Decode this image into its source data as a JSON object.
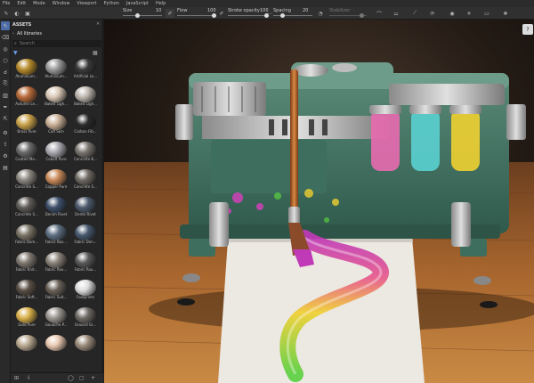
{
  "menu": [
    "File",
    "Edit",
    "Mode",
    "Window",
    "Viewport",
    "Python",
    "JavaScript",
    "Help"
  ],
  "toolbar": {
    "size_label": "Size",
    "size_value": "10",
    "flow_label": "Flow",
    "flow_value": "100",
    "stroke_opacity_label": "Stroke opacity",
    "stroke_opacity_value": "100",
    "spacing_label": "Spacing",
    "spacing_value": "20",
    "stabilizer_label": "Stabilizer"
  },
  "assets": {
    "title": "ASSETS",
    "library": "All libraries",
    "search_placeholder": "Search",
    "items": [
      "Aluminium...",
      "Aluminium...",
      "Artificial Le...",
      "Autumn Le...",
      "Baked Ligh...",
      "Baked Ligh...",
      "Brass Pure",
      "Calf Skin",
      "Carbon Fib...",
      "Coated Me...",
      "Cobalt Pure",
      "Concrete B...",
      "Concrete S...",
      "Copper Pure",
      "Concrete S...",
      "Concrete S...",
      "Denim Rivet",
      "Dente Rivet",
      "Fabric Bam...",
      "Fabric Bas...",
      "Fabric Den...",
      "Fabric Knit...",
      "Fabric Rou...",
      "Fabric Rou...",
      "Fabric Soft...",
      "Fabric Suit...",
      "Footprints",
      "Gold Pure",
      "Gouache P...",
      "Ground Gr...",
      "",
      "",
      ""
    ],
    "colors": [
      "#b58a2a",
      "#9a9a9a",
      "#3a3a3a",
      "#b86a3a",
      "#d9c7b5",
      "#bdb6ae",
      "#c9a24a",
      "#c9b096",
      "#2a2a2a",
      "#6a6a6a",
      "#a9a9b0",
      "#7a7570",
      "#8b8780",
      "#c98a5a",
      "#6f6a62",
      "#5f5c58",
      "#3e4f6a",
      "#4d5a6d",
      "#7b7466",
      "#5e6f82",
      "#48586e",
      "#807870",
      "#8a837a",
      "#5a5a5a",
      "#584e44",
      "#6a6258",
      "#dcdcdc",
      "#d9b04a",
      "#9a9590",
      "#6e6a64",
      "#b8a890",
      "#e8c8b0",
      "#9a8a7a"
    ]
  },
  "viewport": {
    "help": "?"
  }
}
